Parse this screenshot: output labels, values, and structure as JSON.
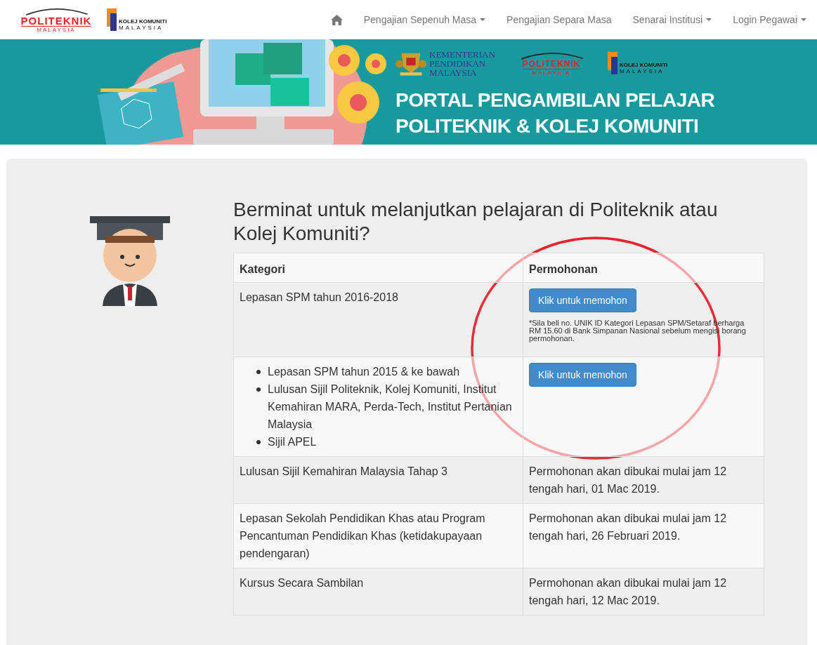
{
  "navbar": {
    "logos": [
      {
        "kind": "politeknik",
        "name": "POLITEKNIK",
        "sub": "MALAYSIA"
      },
      {
        "kind": "kolej",
        "name": "KOLEJ KOMUNITI",
        "sub": "MALAYSIA"
      }
    ],
    "items": [
      {
        "kind": "home"
      },
      {
        "kind": "link",
        "label": "Pengajian Sepenuh Masa",
        "dropdown": true
      },
      {
        "kind": "link",
        "label": "Pengajian Separa Masa",
        "dropdown": false
      },
      {
        "kind": "link",
        "label": "Senarai Institusi",
        "dropdown": true
      },
      {
        "kind": "link",
        "label": "Login Pegawai",
        "dropdown": true
      }
    ]
  },
  "banner": {
    "logos": [
      {
        "kind": "ministry",
        "lines": [
          "KEMENTERIAN",
          "PENDIDIKAN",
          "MALAYSIA"
        ]
      },
      {
        "kind": "politeknik",
        "name": "POLITEKNIK",
        "sub": "MALAYSIA"
      },
      {
        "kind": "kolej",
        "name": "KOLEJ KOMUNITI",
        "sub": "MALAYSIA"
      }
    ],
    "title_lines": [
      "PORTAL PENGAMBILAN PELAJAR",
      "POLITEKNIK & KOLEJ KOMUNITI"
    ]
  },
  "intro": {
    "heading": "Berminat untuk melanjutkan pelajaran di Politeknik atau Kolej Komuniti?"
  },
  "table": {
    "columns": [
      "Kategori",
      "Permohonan"
    ],
    "rows": [
      {
        "category": {
          "kind": "text",
          "text": "Lepasan SPM tahun 2016-2018"
        },
        "application": {
          "kind": "button",
          "button": "Klik untuk memohon",
          "note": "*Sila beli no. UNIK ID Kategori Lepasan SPM/Setaraf berharga RM 15.60 di Bank Simpanan Nasional sebelum mengisi borang permohonan."
        }
      },
      {
        "category": {
          "kind": "list",
          "items": [
            "Lepasan SPM tahun 2015 & ke bawah",
            "Lulusan Sijil Politeknik, Kolej Komuniti, Institut Kemahiran MARA, Perda-Tech, Institut Pertanian Malaysia",
            "Sijil APEL"
          ]
        },
        "application": {
          "kind": "button",
          "button": "Klik untuk memohon"
        }
      },
      {
        "category": {
          "kind": "text",
          "text": "Lulusan Sijil Kemahiran Malaysia Tahap 3"
        },
        "application": {
          "kind": "text",
          "text": "Permohonan akan dibukai mulai jam 12 tengah hari, 01 Mac 2019."
        }
      },
      {
        "category": {
          "kind": "text",
          "text": "Lepasan Sekolah Pendidikan Khas atau Program Pencantuman Pendidikan Khas (ketidakupayaan pendengaran)"
        },
        "application": {
          "kind": "text",
          "text": "Permohonan akan dibukai mulai jam 12 tengah hari, 26 Februari 2019."
        }
      },
      {
        "category": {
          "kind": "text",
          "text": "Kursus Secara Sambilan"
        },
        "application": {
          "kind": "text",
          "text": "Permohonan akan dibukai mulai jam 12 tengah hari, 12 Mac 2019."
        }
      }
    ]
  },
  "annotation": {
    "kind": "ellipse",
    "color": "#e8212a"
  }
}
